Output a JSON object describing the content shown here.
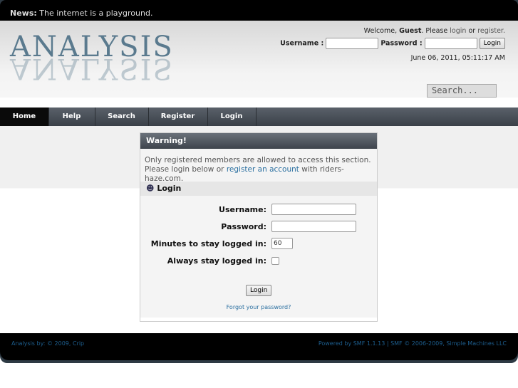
{
  "news": {
    "label": "News:",
    "text": "The internet is a playground."
  },
  "logo": "ANALYSIS",
  "user": {
    "welcome": "Welcome,",
    "guest": "Guest",
    "please": ". Please",
    "login": "login",
    "or": "or",
    "register": "register.",
    "username_label": "Username :",
    "password_label": "Password :",
    "login_button": "Login",
    "date": "June 06, 2011, 05:11:17 AM"
  },
  "search": {
    "placeholder": "Search..."
  },
  "nav": [
    "Home",
    "Help",
    "Search",
    "Register",
    "Login"
  ],
  "warning": {
    "title": "Warning!",
    "line1": "Only registered members are allowed to access this section.",
    "line2a": "Please login below or",
    "link": "register an account",
    "line2b": "with riders-haze.com."
  },
  "login": {
    "title": "Login",
    "username": "Username:",
    "password": "Password:",
    "minutes": "Minutes to stay logged in:",
    "minutes_value": "60",
    "always": "Always stay logged in:",
    "button": "Login",
    "forgot": "Forgot your password?"
  },
  "footer": {
    "left": "Analysis by: © 2009, Crip",
    "right": "Powered by SMF 1.1.13 | SMF © 2006-2009, Simple Machines LLC"
  }
}
